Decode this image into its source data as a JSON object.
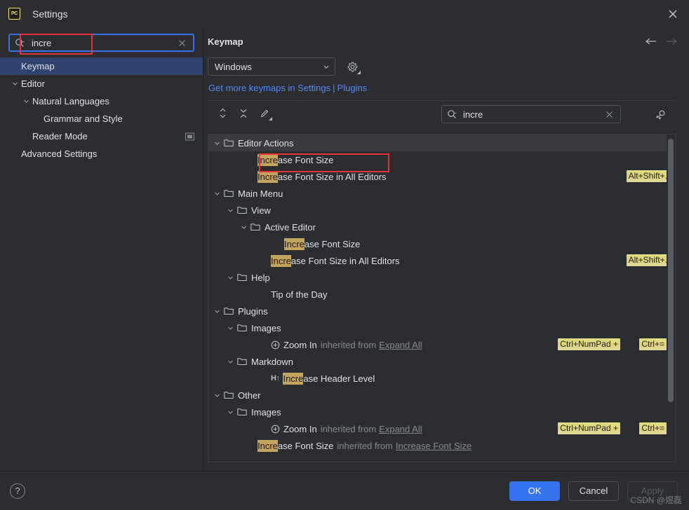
{
  "window": {
    "title": "Settings",
    "app_icon": "pycharm-icon",
    "app_icon_text": "PC",
    "close_icon": "close-icon"
  },
  "sidebar": {
    "search": {
      "value": "incre",
      "placeholder": "",
      "icon": "search-icon",
      "clear_icon": "clear-icon"
    },
    "items": [
      {
        "label": "Keymap",
        "indent": 0,
        "selected": true,
        "twisty": "",
        "extra_icon": ""
      },
      {
        "label": "Editor",
        "indent": 0,
        "selected": false,
        "twisty": "chevron-down-icon",
        "extra_icon": ""
      },
      {
        "label": "Natural Languages",
        "indent": 1,
        "selected": false,
        "twisty": "chevron-down-icon",
        "extra_icon": ""
      },
      {
        "label": "Grammar and Style",
        "indent": 2,
        "selected": false,
        "twisty": "",
        "extra_icon": ""
      },
      {
        "label": "Reader Mode",
        "indent": 1,
        "selected": false,
        "twisty": "",
        "extra_icon": "preview-panel-icon"
      },
      {
        "label": "Advanced Settings",
        "indent": 0,
        "selected": false,
        "twisty": "",
        "extra_icon": ""
      }
    ]
  },
  "content": {
    "title": "Keymap",
    "nav": {
      "back_icon": "arrow-left-icon",
      "forward_icon": "arrow-right-icon"
    },
    "keymap_select": {
      "value": "Windows",
      "chevron": "chevron-down-icon"
    },
    "settings_gear": "gear-icon",
    "links": {
      "get_more": "Get more keymaps in Settings",
      "separator": "|",
      "plugins": "Plugins"
    },
    "toolbar": {
      "expand_collapse_icon": "expand-collapse-icon",
      "collapse_all_icon": "collapse-all-icon",
      "edit_shortcut_icon": "pencil-edit-icon",
      "find_by_shortcut_icon": "find-by-shortcut-icon"
    },
    "tree_search": {
      "value": "incre",
      "icon": "search-icon",
      "clear_icon": "clear-icon"
    }
  },
  "tree": [
    {
      "label": "Editor Actions",
      "kind": "folder",
      "depth": 0,
      "selected": true,
      "twisty": "chevron-down-icon",
      "highlight": "",
      "rest": "",
      "shortcut": "",
      "shortcut2": "",
      "inherited_from": "",
      "lead_icon": ""
    },
    {
      "label": "",
      "kind": "action",
      "depth": 1,
      "selected": false,
      "twisty": "",
      "highlight": "Incre",
      "rest": "ase Font Size",
      "shortcut": "",
      "shortcut2": "",
      "inherited_from": "",
      "lead_icon": ""
    },
    {
      "label": "",
      "kind": "action",
      "depth": 1,
      "selected": false,
      "twisty": "",
      "highlight": "Incre",
      "rest": "ase Font Size in All Editors",
      "shortcut": "Alt+Shift+.",
      "shortcut2": "",
      "inherited_from": "",
      "lead_icon": ""
    },
    {
      "label": "Main Menu",
      "kind": "folder",
      "depth": 0,
      "selected": false,
      "twisty": "chevron-down-icon",
      "highlight": "",
      "rest": "",
      "shortcut": "",
      "shortcut2": "",
      "inherited_from": "",
      "lead_icon": ""
    },
    {
      "label": "View",
      "kind": "folder",
      "depth": 1,
      "selected": false,
      "twisty": "chevron-down-icon",
      "highlight": "",
      "rest": "",
      "shortcut": "",
      "shortcut2": "",
      "inherited_from": "",
      "lead_icon": ""
    },
    {
      "label": "Active Editor",
      "kind": "folder",
      "depth": 2,
      "selected": false,
      "twisty": "chevron-down-icon",
      "highlight": "",
      "rest": "",
      "shortcut": "",
      "shortcut2": "",
      "inherited_from": "",
      "lead_icon": ""
    },
    {
      "label": "",
      "kind": "action",
      "depth": 3,
      "selected": false,
      "twisty": "",
      "highlight": "Incre",
      "rest": "ase Font Size",
      "shortcut": "",
      "shortcut2": "",
      "inherited_from": "",
      "lead_icon": ""
    },
    {
      "label": "",
      "kind": "action",
      "depth": 2,
      "selected": false,
      "twisty": "",
      "highlight": "Incre",
      "rest": "ase Font Size in All Editors",
      "shortcut": "Alt+Shift+.",
      "shortcut2": "",
      "inherited_from": "",
      "lead_icon": ""
    },
    {
      "label": "Help",
      "kind": "folder",
      "depth": 1,
      "selected": false,
      "twisty": "chevron-down-icon",
      "highlight": "",
      "rest": "",
      "shortcut": "",
      "shortcut2": "",
      "inherited_from": "",
      "lead_icon": ""
    },
    {
      "label": "",
      "kind": "action",
      "depth": 2,
      "selected": false,
      "twisty": "",
      "highlight": "",
      "rest": "Tip of the Day",
      "shortcut": "",
      "shortcut2": "",
      "inherited_from": "",
      "lead_icon": ""
    },
    {
      "label": "Plugins",
      "kind": "folder",
      "depth": 0,
      "selected": false,
      "twisty": "chevron-down-icon",
      "highlight": "",
      "rest": "",
      "shortcut": "",
      "shortcut2": "",
      "inherited_from": "",
      "lead_icon": ""
    },
    {
      "label": "Images",
      "kind": "folder",
      "depth": 1,
      "selected": false,
      "twisty": "chevron-down-icon",
      "highlight": "",
      "rest": "",
      "shortcut": "",
      "shortcut2": "",
      "inherited_from": "",
      "lead_icon": ""
    },
    {
      "label": "",
      "kind": "action",
      "depth": 2,
      "selected": false,
      "twisty": "",
      "highlight": "",
      "rest": "Zoom In",
      "shortcut": "Ctrl+NumPad +",
      "shortcut2": "Ctrl+=",
      "inherited_label": "inherited from",
      "inherited_from": "Expand All",
      "lead_icon": "zoom-in-plus-icon"
    },
    {
      "label": "Markdown",
      "kind": "folder",
      "depth": 1,
      "selected": false,
      "twisty": "chevron-down-icon",
      "highlight": "",
      "rest": "",
      "shortcut": "",
      "shortcut2": "",
      "inherited_from": "",
      "lead_icon": ""
    },
    {
      "label": "",
      "kind": "action",
      "depth": 2,
      "selected": false,
      "twisty": "",
      "highlight": "Incre",
      "rest": "ase Header Level",
      "shortcut": "",
      "shortcut2": "",
      "inherited_from": "",
      "lead_icon": "header-increase-icon",
      "lead_text": "H↑"
    },
    {
      "label": "Other",
      "kind": "folder",
      "depth": 0,
      "selected": false,
      "twisty": "chevron-down-icon",
      "highlight": "",
      "rest": "",
      "shortcut": "",
      "shortcut2": "",
      "inherited_from": "",
      "lead_icon": ""
    },
    {
      "label": "Images",
      "kind": "folder",
      "depth": 1,
      "selected": false,
      "twisty": "chevron-down-icon",
      "highlight": "",
      "rest": "",
      "shortcut": "",
      "shortcut2": "",
      "inherited_from": "",
      "lead_icon": ""
    },
    {
      "label": "",
      "kind": "action",
      "depth": 2,
      "selected": false,
      "twisty": "",
      "highlight": "",
      "rest": "Zoom In",
      "shortcut": "Ctrl+NumPad +",
      "shortcut2": "Ctrl+=",
      "inherited_label": "inherited from",
      "inherited_from": "Expand All",
      "lead_icon": "zoom-in-plus-icon"
    },
    {
      "label": "",
      "kind": "action",
      "depth": 2,
      "selected": false,
      "twisty": "",
      "highlight": "Incre",
      "rest": "ase Font Size",
      "shortcut": "",
      "shortcut2": "",
      "inherited_label": "inherited from",
      "inherited_from": "Increase Font Size",
      "lead_icon": ""
    }
  ],
  "footer": {
    "help_icon": "help-question-icon",
    "ok": "OK",
    "cancel": "Cancel",
    "apply": "Apply",
    "watermark": "CSDN @煜磊"
  },
  "colors": {
    "window_bg": "#2b2d30",
    "accent_blue": "#3574f0",
    "link_blue": "#548af7",
    "selection_blue": "#2e436e",
    "match_highlight": "#c5a45d",
    "shortcut_badge": "#dcd477",
    "annotation_red": "#e8333a",
    "border": "#393b40"
  }
}
